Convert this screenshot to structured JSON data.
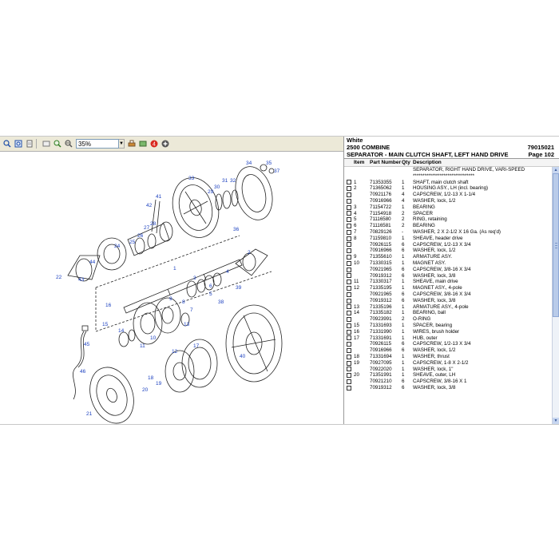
{
  "toolbar": {
    "zoom_value": "35%",
    "icons": [
      "zoom-in-icon",
      "fit-page-icon",
      "page-icon",
      "page-nav-icon",
      "zoom-window-icon",
      "zoom-out-icon",
      "print-icon",
      "tools-icon",
      "stop-icon",
      "add-icon"
    ]
  },
  "drawing": {
    "callouts": [
      "37",
      "35",
      "34",
      "33",
      "31",
      "32",
      "30",
      "29",
      "28",
      "27",
      "26",
      "25",
      "24",
      "36",
      "41",
      "42",
      "22",
      "43",
      "44",
      "1",
      "2",
      "3",
      "4",
      "5",
      "6",
      "7",
      "8",
      "9",
      "10",
      "11",
      "12",
      "13",
      "14",
      "15",
      "16",
      "17",
      "18",
      "19",
      "20",
      "21",
      "38",
      "39",
      "40",
      "45",
      "46"
    ]
  },
  "parts": {
    "brand": "White",
    "model": "2500 COMBINE",
    "model_code": "79015021",
    "section_title": "SEPARATOR - MAIN CLUTCH SHAFT, LEFT HAND DRIVE",
    "page": "Page 102",
    "col_item": "Item",
    "col_part": "Part Number",
    "col_qty": "Qty",
    "col_desc": "Description",
    "rows": [
      {
        "item": "",
        "part": "",
        "qty": "",
        "desc": "SEPARATOR, RIGHT HAND DRIVE, VARI-SPEED",
        "check": false
      },
      {
        "item": "",
        "part": "",
        "qty": "",
        "desc": "********************************",
        "check": false
      },
      {
        "item": "1",
        "part": "71353355",
        "qty": "1",
        "desc": "SHAFT, main clutch shaft",
        "check": true
      },
      {
        "item": "2",
        "part": "71365062",
        "qty": "1",
        "desc": "HOUSING ASY., LH (incl. bearing)",
        "check": true
      },
      {
        "item": "",
        "part": "70921176",
        "qty": "4",
        "desc": "CAPSCREW, 1/2-13 X 1-1/4",
        "check": true
      },
      {
        "item": "",
        "part": "70916966",
        "qty": "4",
        "desc": "WASHER, lock, 1/2",
        "check": true
      },
      {
        "item": "3",
        "part": "71154722",
        "qty": "1",
        "desc": "BEARING",
        "check": true
      },
      {
        "item": "4",
        "part": "71154918",
        "qty": "2",
        "desc": "SPACER",
        "check": true
      },
      {
        "item": "5",
        "part": "71116580",
        "qty": "2",
        "desc": "RING, retaining",
        "check": true
      },
      {
        "item": "6",
        "part": "71116581",
        "qty": "2",
        "desc": "BEARING",
        "check": true
      },
      {
        "item": "7",
        "part": "70829126",
        "qty": "-",
        "desc": "WASHER, 2 X 2-1/2 X 16 Ga. (As req'd)",
        "check": true
      },
      {
        "item": "8",
        "part": "71159810",
        "qty": "1",
        "desc": "SHEAVE, header drive",
        "check": true
      },
      {
        "item": "",
        "part": "70926115",
        "qty": "6",
        "desc": "CAPSCREW, 1/2-13 X 3/4",
        "check": true
      },
      {
        "item": "",
        "part": "70916966",
        "qty": "6",
        "desc": "WASHER, lock, 1/2",
        "check": true
      },
      {
        "item": "9",
        "part": "71355610",
        "qty": "1",
        "desc": "ARMATURE ASY.",
        "check": true
      },
      {
        "item": "10",
        "part": "71330315",
        "qty": "1",
        "desc": "MAGNET ASY.",
        "check": true
      },
      {
        "item": "",
        "part": "70921965",
        "qty": "6",
        "desc": "CAPSCREW, 3/8-16 X 3/4",
        "check": true
      },
      {
        "item": "",
        "part": "70919312",
        "qty": "6",
        "desc": "WASHER, lock, 3/8",
        "check": true
      },
      {
        "item": "11",
        "part": "71330317",
        "qty": "1",
        "desc": "SHEAVE, main drive",
        "check": true
      },
      {
        "item": "12",
        "part": "71335195",
        "qty": "1",
        "desc": "MAGNET ASY., 4-pole",
        "check": true
      },
      {
        "item": "",
        "part": "70921965",
        "qty": "6",
        "desc": "CAPSCREW, 3/8-16 X 3/4",
        "check": true
      },
      {
        "item": "",
        "part": "70919312",
        "qty": "6",
        "desc": "WASHER, lock, 3/8",
        "check": true
      },
      {
        "item": "13",
        "part": "71335196",
        "qty": "1",
        "desc": "ARMATURE ASY., 4-pole",
        "check": true
      },
      {
        "item": "14",
        "part": "71335182",
        "qty": "1",
        "desc": "BEARING, ball",
        "check": true
      },
      {
        "item": "",
        "part": "70923991",
        "qty": "2",
        "desc": "O-RING",
        "check": true
      },
      {
        "item": "15",
        "part": "71331693",
        "qty": "1",
        "desc": "SPACER, bearing",
        "check": true
      },
      {
        "item": "16",
        "part": "71331990",
        "qty": "1",
        "desc": "WIRES, brush holder",
        "check": true
      },
      {
        "item": "17",
        "part": "71331691",
        "qty": "1",
        "desc": "HUB, outer",
        "check": true
      },
      {
        "item": "",
        "part": "70926115",
        "qty": "6",
        "desc": "CAPSCREW, 1/2-13 X 3/4",
        "check": true
      },
      {
        "item": "",
        "part": "70916966",
        "qty": "6",
        "desc": "WASHER, lock, 1/2",
        "check": true
      },
      {
        "item": "18",
        "part": "71331694",
        "qty": "1",
        "desc": "WASHER, thrust",
        "check": true
      },
      {
        "item": "19",
        "part": "70927095",
        "qty": "1",
        "desc": "CAPSCREW, 1-8 X 2-1/2",
        "check": true
      },
      {
        "item": "",
        "part": "70922020",
        "qty": "1",
        "desc": "WASHER, lock, 1\"",
        "check": true
      },
      {
        "item": "20",
        "part": "71351991",
        "qty": "1",
        "desc": "SHEAVE, outer, LH",
        "check": true
      },
      {
        "item": "",
        "part": "70921210",
        "qty": "6",
        "desc": "CAPSCREW, 3/8-16 X 1",
        "check": true
      },
      {
        "item": "",
        "part": "70919312",
        "qty": "6",
        "desc": "WASHER, lock, 3/8",
        "check": true
      }
    ]
  }
}
